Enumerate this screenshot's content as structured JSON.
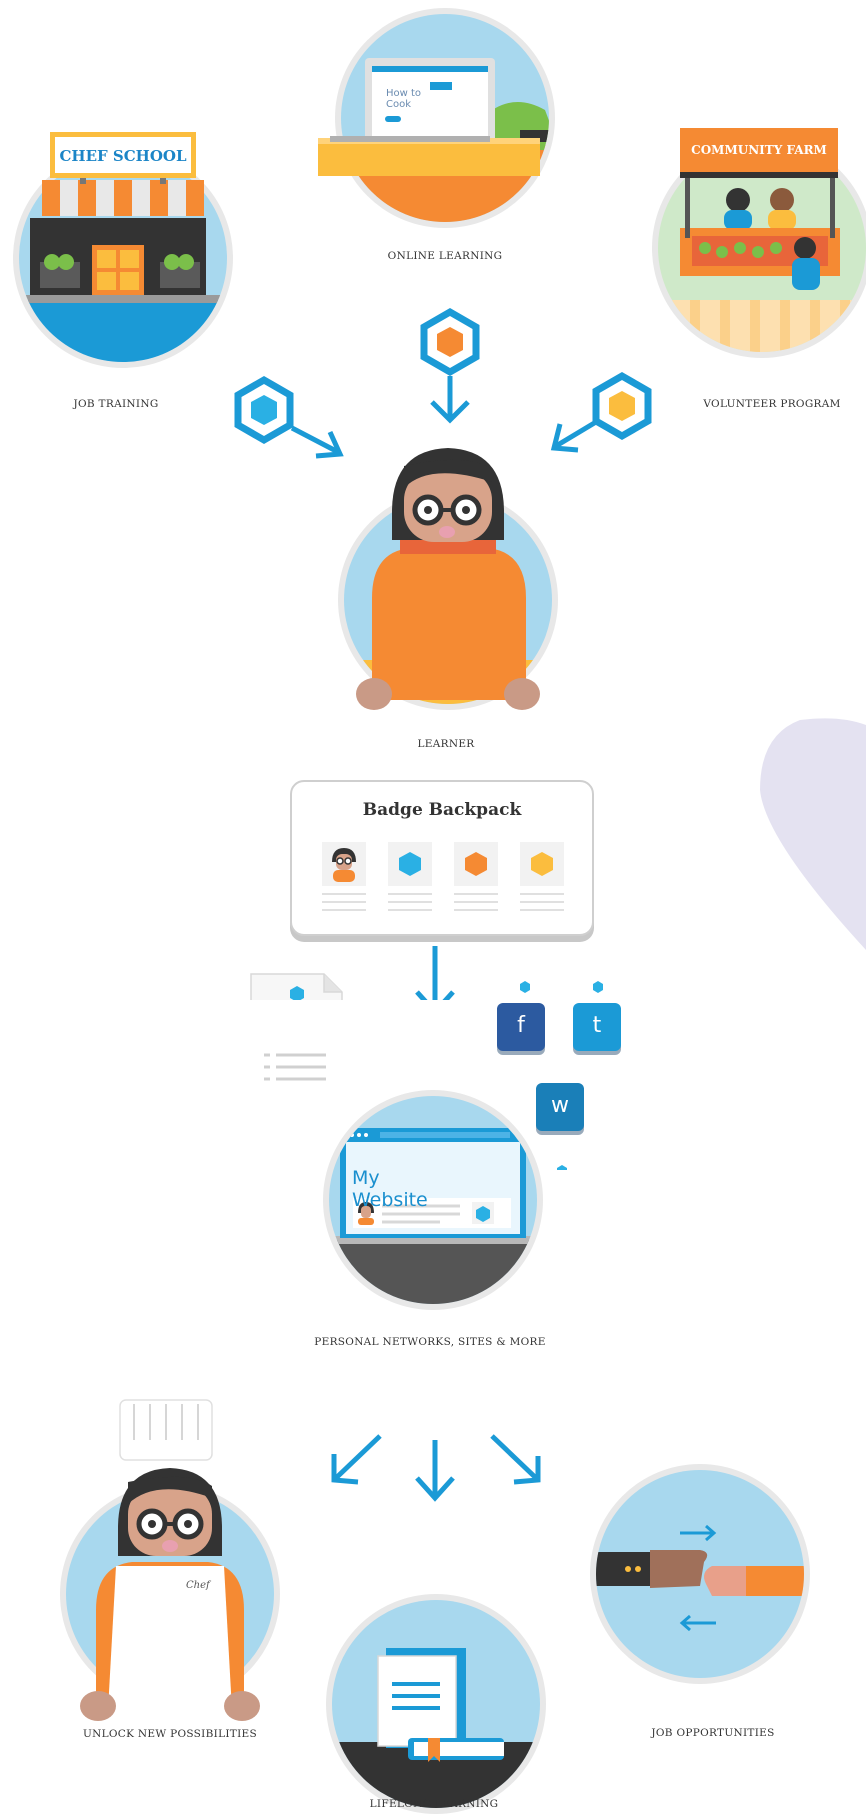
{
  "nodes": {
    "online_learning": "ONLINE LEARNING",
    "job_training": "JOB TRAINING",
    "volunteer_program": "VOLUNTEER PROGRAM",
    "learner": "LEARNER",
    "personal_networks": "PERSONAL NETWORKS, SITES & MORE",
    "unlock": "UNLOCK NEW POSSIBILITIES",
    "lifelong": "LIFELONG LEARNING",
    "job_opportunities": "JOB OPPORTUNITIES"
  },
  "signs": {
    "chef_school": "CHEF SCHOOL",
    "community_farm": "COMMUNITY FARM",
    "how_to_cook": [
      "How to",
      "Cook"
    ],
    "chef": "Chef"
  },
  "backpack": {
    "title": "Badge Backpack"
  },
  "website": {
    "title": "My Website"
  },
  "social": {
    "facebook": "f",
    "twitter": "t",
    "wordpress": "w"
  },
  "colors": {
    "blue": "#1b9ad6",
    "light_blue": "#a8d8ee",
    "orange": "#f58a33",
    "yellow": "#fbbd3e",
    "cyan_badge": "#2ab0e4",
    "lavender": "#e4e2f1",
    "dark": "#333333"
  }
}
